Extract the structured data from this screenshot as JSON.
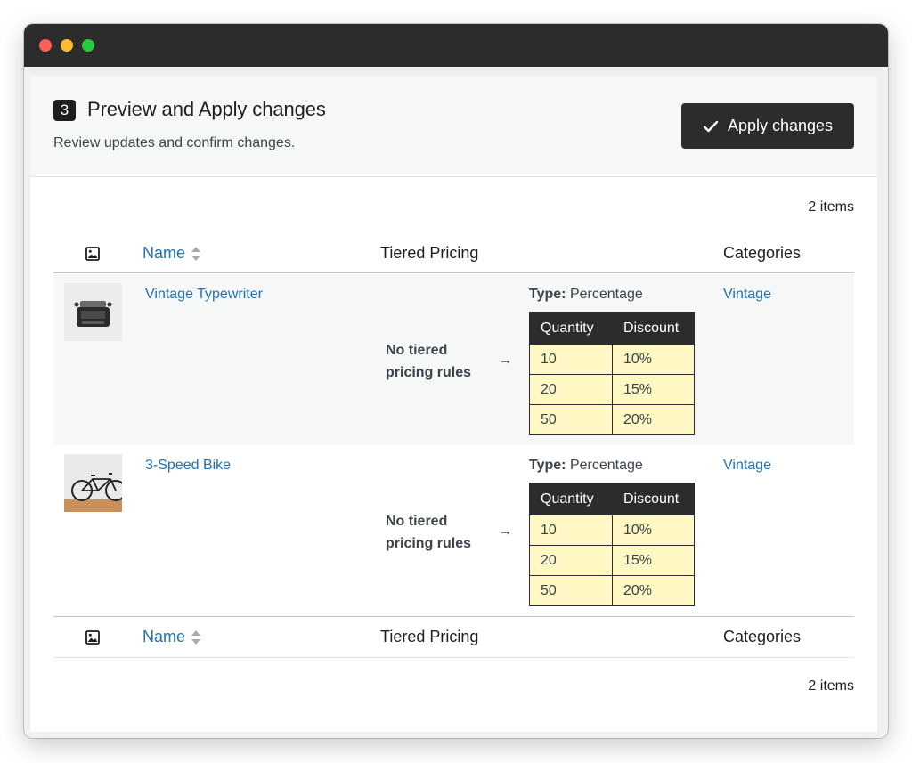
{
  "step": {
    "number": "3",
    "title": "Preview and Apply changes",
    "subtitle": "Review updates and confirm changes."
  },
  "actions": {
    "apply_label": "Apply changes"
  },
  "table": {
    "count_label": "2 items",
    "columns": {
      "image_icon": "image-icon",
      "name": "Name",
      "tiered_pricing": "Tiered Pricing",
      "categories": "Categories"
    },
    "rows": [
      {
        "name": "Vintage Typewriter",
        "current_rules": "No tiered pricing rules",
        "type_label": "Type:",
        "type_value": "Percentage",
        "tier_headers": [
          "Quantity",
          "Discount"
        ],
        "tiers": [
          {
            "quantity": "10",
            "discount": "10%"
          },
          {
            "quantity": "20",
            "discount": "15%"
          },
          {
            "quantity": "50",
            "discount": "20%"
          }
        ],
        "category": "Vintage"
      },
      {
        "name": "3-Speed Bike",
        "current_rules": "No tiered pricing rules",
        "type_label": "Type:",
        "type_value": "Percentage",
        "tier_headers": [
          "Quantity",
          "Discount"
        ],
        "tiers": [
          {
            "quantity": "10",
            "discount": "10%"
          },
          {
            "quantity": "20",
            "discount": "15%"
          },
          {
            "quantity": "50",
            "discount": "20%"
          }
        ],
        "category": "Vintage"
      }
    ]
  },
  "colors": {
    "link": "#2271b1",
    "dark": "#2c2c2c",
    "highlight": "#fff8c5"
  }
}
